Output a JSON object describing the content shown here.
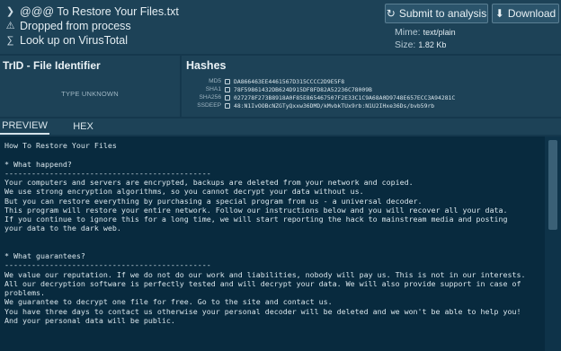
{
  "header": {
    "filename": "@@@ To Restore Your Files.txt",
    "dropped": "Dropped from process",
    "virustotal": "Look up on VirusTotal",
    "submit_label": "Submit to analysis",
    "download_label": "Download",
    "mime_label": "Mime:",
    "mime_value": "text/plain",
    "size_label": "Size:",
    "size_value": "1.82 Kb"
  },
  "trid": {
    "title": "TrID - File Identifier",
    "status": "TYPE UNKNOWN"
  },
  "hashes": {
    "title": "Hashes",
    "rows": [
      {
        "label": "MD5",
        "value": "DA866463EE4461567D315CCCC2D9E5F8"
      },
      {
        "label": "SHA1",
        "value": "78F59861432DB624D915DF8FD82A52236C78009B"
      },
      {
        "label": "SHA256",
        "value": "027278F273B8918A0F85E865467507F2E33C1C9A68A0D9748E657ECC3A94281C"
      },
      {
        "label": "SSDEEP",
        "value": "48:N1IvOOBcNZGTyQxxw36DMD/kMvbkTUx9rb:N1U2IHxe36Ds/bvb59rb"
      }
    ]
  },
  "tabs": {
    "preview": "PREVIEW",
    "hex": "HEX"
  },
  "content": {
    "text": "How To Restore Your Files\n\n* What happend?\n----------------------------------------------\nYour computers and servers are encrypted, backups are deleted from your network and copied.\nWe use strong encryption algorithms, so you cannot decrypt your data without us.\nBut you can restore everything by purchasing a special program from us - a universal decoder.\nThis program will restore your entire network. Follow our instructions below and you will recover all your data.\nIf you continue to ignore this for a long time, we will start reporting the hack to mainstream media and posting\nyour data to the dark web.\n\n\n* What guarantees?\n----------------------------------------------\nWe value our reputation. If we do not do our work and liabilities, nobody will pay us. This is not in our interests.\nAll our decryption software is perfectly tested and will decrypt your data. We will also provide support in case of\nproblems.\nWe guarantee to decrypt one file for free. Go to the site and contact us.\nYou have three days to contact us otherwise your personal decoder will be deleted and we won't be able to help you!\nAnd your personal data will be public."
  }
}
